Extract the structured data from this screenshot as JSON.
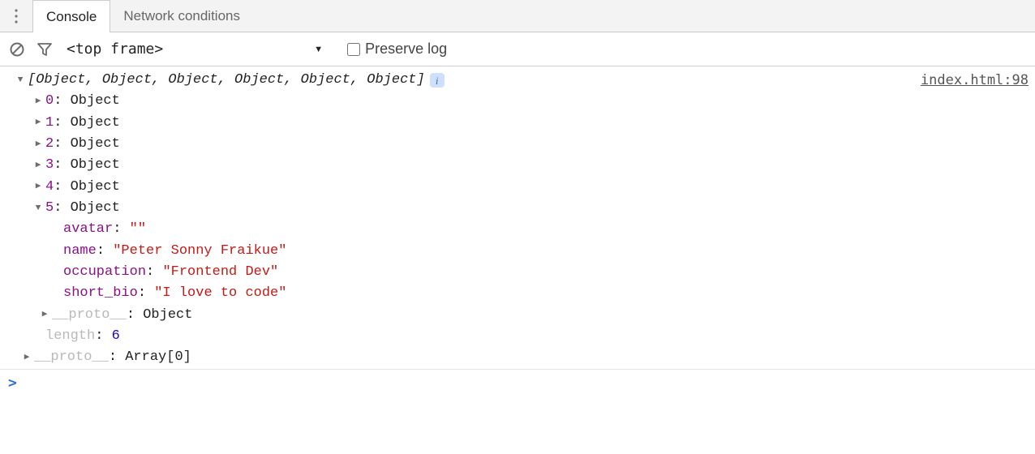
{
  "tabs": {
    "console": "Console",
    "network_conditions": "Network conditions"
  },
  "toolbar": {
    "context": "<top frame>",
    "preserve_log_label": "Preserve log"
  },
  "source_link": "index.html:98",
  "log": {
    "summary": "[Object, Object, Object, Object, Object, Object]",
    "items": [
      {
        "idx": "0",
        "type": "Object"
      },
      {
        "idx": "1",
        "type": "Object"
      },
      {
        "idx": "2",
        "type": "Object"
      },
      {
        "idx": "3",
        "type": "Object"
      },
      {
        "idx": "4",
        "type": "Object"
      },
      {
        "idx": "5",
        "type": "Object"
      }
    ],
    "expanded": {
      "avatar_key": "avatar",
      "avatar_val": "\"\"",
      "name_key": "name",
      "name_val": "\"Peter Sonny Fraikue\"",
      "occupation_key": "occupation",
      "occupation_val": "\"Frontend Dev\"",
      "short_bio_key": "short_bio",
      "short_bio_val": "\"I love to code\"",
      "proto_key": "__proto__",
      "proto_val": "Object"
    },
    "length_key": "length",
    "length_val": "6",
    "outer_proto_key": "__proto__",
    "outer_proto_val": "Array[0]"
  },
  "info_badge": "i",
  "prompt": ">"
}
